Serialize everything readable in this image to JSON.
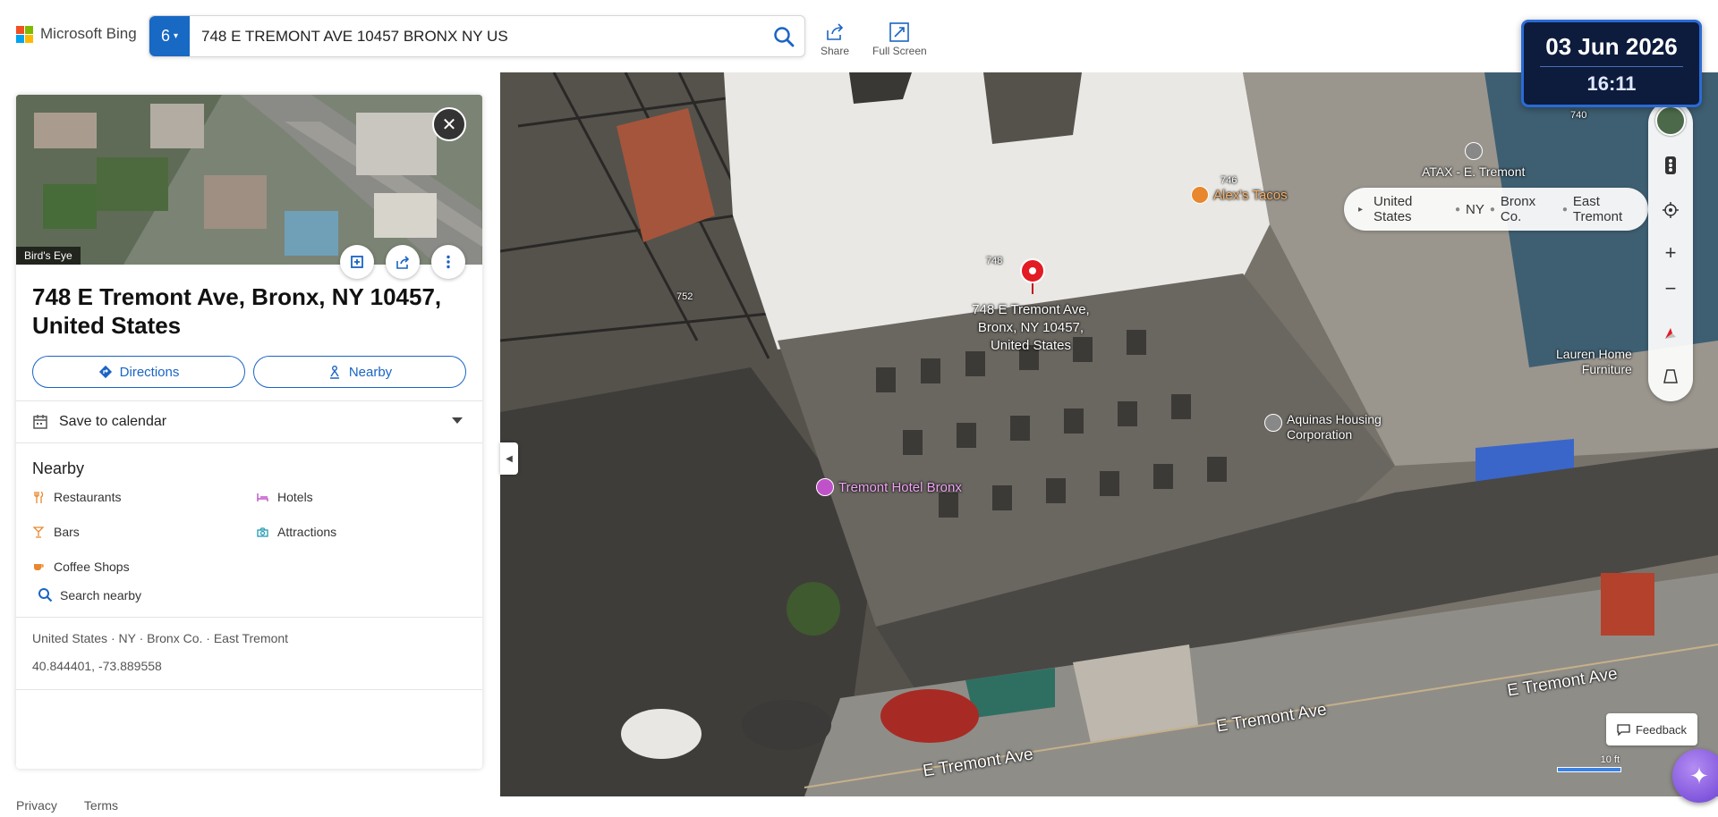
{
  "brand": {
    "name": "Microsoft Bing",
    "colors": [
      "#f25022",
      "#7fba00",
      "#00a4ef",
      "#ffb900"
    ]
  },
  "search": {
    "zoom_level": "6",
    "query": "748 E TREMONT AVE 10457 BRONX NY US"
  },
  "header_actions": {
    "share_label": "Share",
    "fullscreen_label": "Full Screen"
  },
  "datetime": {
    "date": "03 Jun 2026",
    "time": "16:11"
  },
  "panel": {
    "image_badge": "Bird's Eye",
    "title": "748 E Tremont Ave, Bronx, NY 10457, United States",
    "directions_label": "Directions",
    "nearby_button_label": "Nearby",
    "calendar_label": "Save to calendar",
    "nearby_heading": "Nearby",
    "nearby_items": [
      {
        "label": "Restaurants",
        "icon": "fork-knife-icon"
      },
      {
        "label": "Hotels",
        "icon": "bed-icon"
      },
      {
        "label": "Bars",
        "icon": "cocktail-icon"
      },
      {
        "label": "Attractions",
        "icon": "camera-icon"
      },
      {
        "label": "Coffee Shops",
        "icon": "coffee-icon"
      }
    ],
    "search_nearby_label": "Search nearby",
    "location_path": "United States · NY · Bronx Co. · East Tremont",
    "coordinates": "40.844401, -73.889558"
  },
  "footer": {
    "privacy": "Privacy",
    "terms": "Terms"
  },
  "map": {
    "pin_address_line1": "748 E Tremont Ave,",
    "pin_address_line2": "Bronx, NY 10457,",
    "pin_address_line3": "United States",
    "house_numbers": [
      "748",
      "752",
      "746",
      "740"
    ],
    "pois": {
      "alexs_tacos": "Alex's Tacos",
      "atax": "ATAX - E. Tremont",
      "aquinas_line1": "Aquinas Housing",
      "aquinas_line2": "Corporation",
      "tremont_hotel": "Tremont Hotel Bronx",
      "lauren_line1": "Lauren Home",
      "lauren_line2": "Furniture"
    },
    "street_label": "E Tremont Ave",
    "breadcrumb": [
      "United States",
      "NY",
      "Bronx Co.",
      "East Tremont"
    ],
    "feedback_label": "Feedback",
    "scale_label": "10 ft"
  }
}
